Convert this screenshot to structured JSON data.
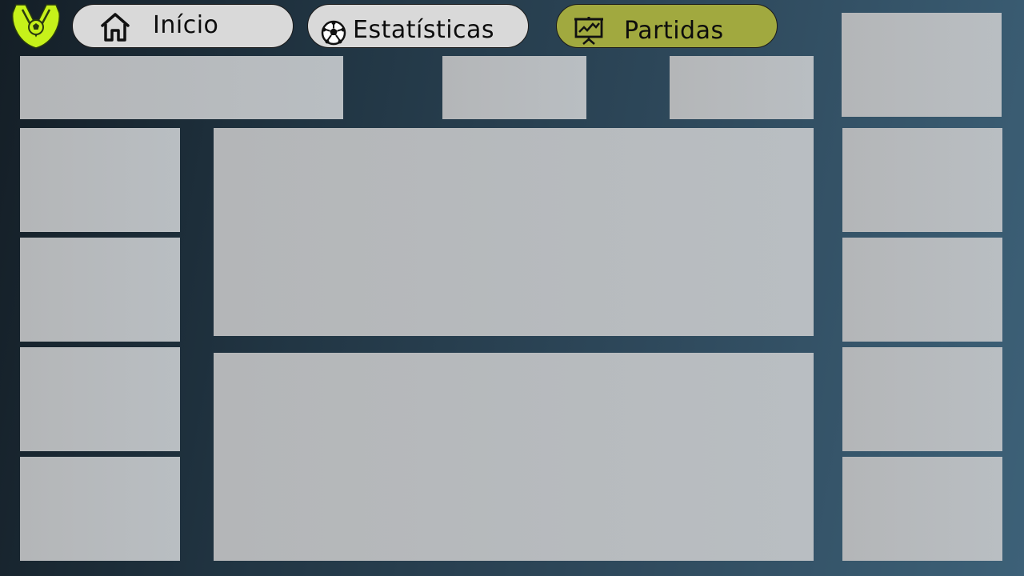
{
  "nav": {
    "items": [
      {
        "label": "Início",
        "icon": "home-icon",
        "active": false
      },
      {
        "label": "Estatísticas",
        "icon": "soccer-ball-icon",
        "active": false
      },
      {
        "label": "Partidas",
        "icon": "presentation-chart-icon",
        "active": true
      }
    ]
  },
  "logo": {
    "icon": "league-logo-icon"
  },
  "colors": {
    "background_start": "#141e26",
    "background_end": "#3d6178",
    "button_bg": "#d9d9d9",
    "button_active_bg": "#a1a93f",
    "logo_green": "#c6f11a",
    "card_bg": "#b7babd"
  }
}
